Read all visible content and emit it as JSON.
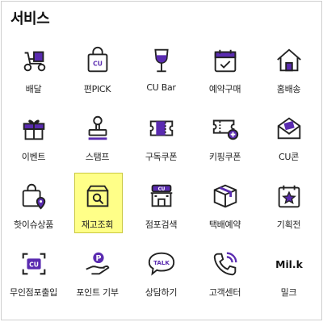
{
  "section_title": "서비스",
  "colors": {
    "purple": "#5a2bb0",
    "lime": "#8dc63f",
    "highlight": "#ffff88",
    "dark": "#222222"
  },
  "items": [
    {
      "label": "배달",
      "icon": "delivery-scooter-icon"
    },
    {
      "label": "편PICK",
      "icon": "cu-shopping-bag-icon"
    },
    {
      "label": "CU Bar",
      "icon": "wine-glass-icon"
    },
    {
      "label": "예약구매",
      "icon": "calendar-check-icon"
    },
    {
      "label": "홈배송",
      "icon": "home-icon"
    },
    {
      "label": "이벤트",
      "icon": "gift-box-icon"
    },
    {
      "label": "스탬프",
      "icon": "stamp-icon"
    },
    {
      "label": "구독쿠폰",
      "icon": "coupon-ticket-icon"
    },
    {
      "label": "키핑쿠폰",
      "icon": "coupon-add-icon"
    },
    {
      "label": "CU콘",
      "icon": "envelope-icon"
    },
    {
      "label": "핫이슈상품",
      "icon": "bag-location-icon"
    },
    {
      "label": "재고조회",
      "icon": "box-search-icon"
    },
    {
      "label": "점포검색",
      "icon": "store-icon"
    },
    {
      "label": "택배예약",
      "icon": "parcel-icon"
    },
    {
      "label": "기획전",
      "icon": "calendar-star-icon"
    },
    {
      "label": "무인점포출입",
      "icon": "cu-scan-icon"
    },
    {
      "label": "포인트 기부",
      "icon": "point-donate-icon"
    },
    {
      "label": "상담하기",
      "icon": "talk-bubble-icon"
    },
    {
      "label": "고객센터",
      "icon": "phone-icon"
    },
    {
      "label": "밀크",
      "icon": "milk-logo-icon",
      "logo_text": "Mil.k"
    }
  ]
}
